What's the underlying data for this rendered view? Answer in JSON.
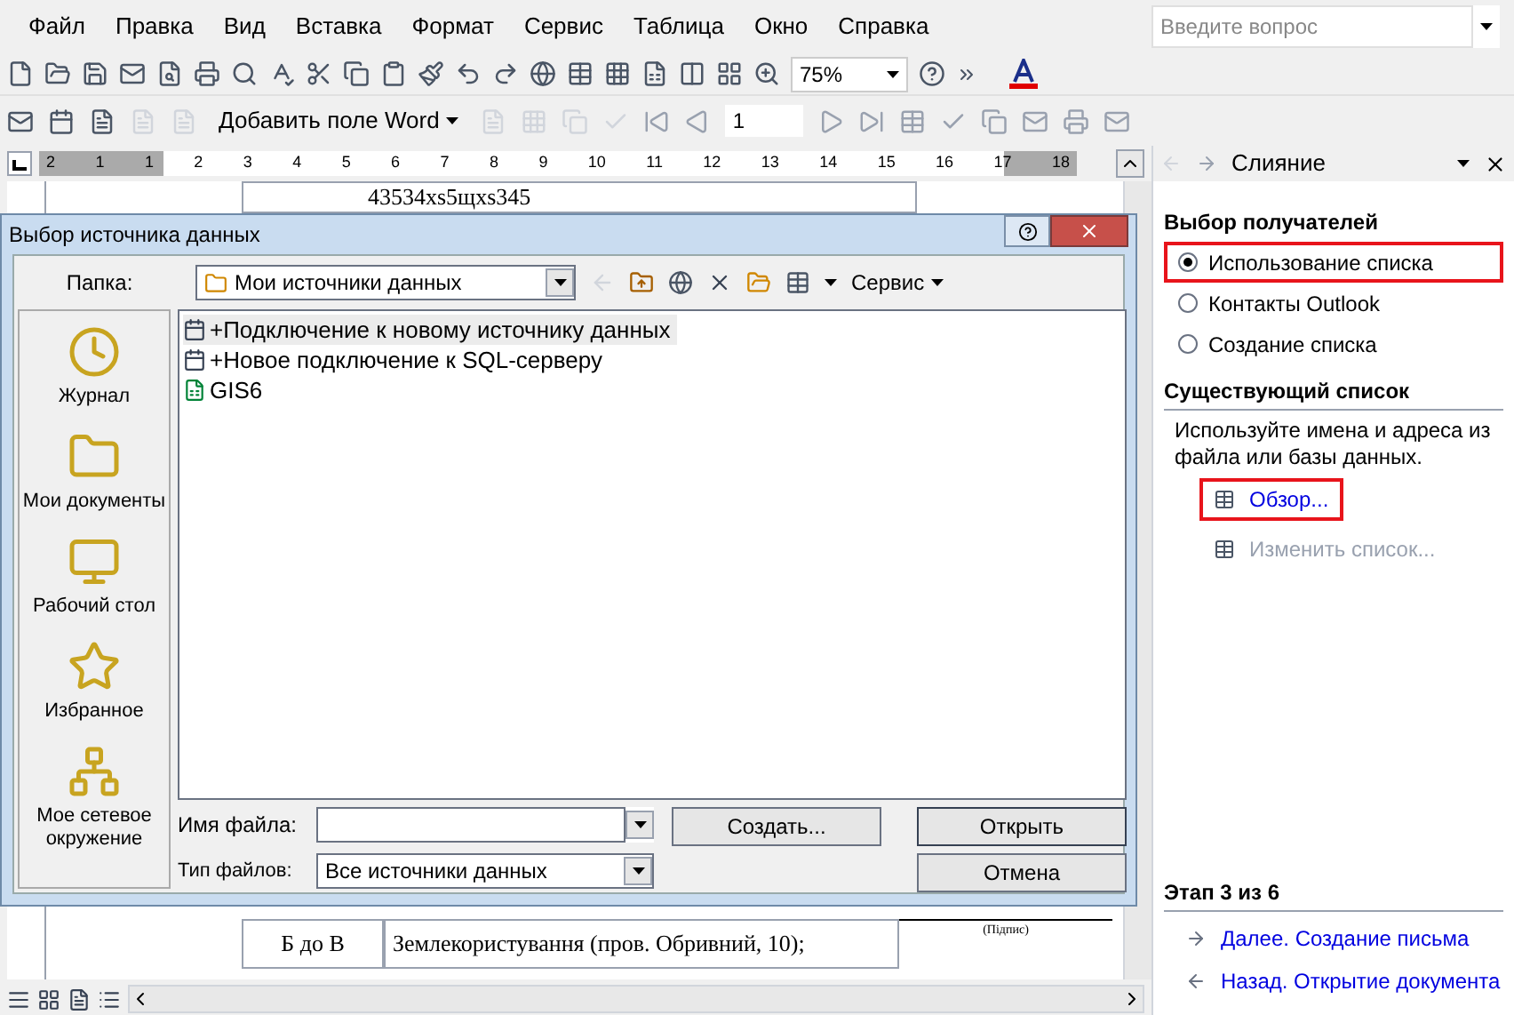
{
  "menu": [
    {
      "label": "Файл"
    },
    {
      "label": "Правка"
    },
    {
      "label": "Вид"
    },
    {
      "label": "Вставка"
    },
    {
      "label": "Формат"
    },
    {
      "label": "Сервис"
    },
    {
      "label": "Таблица"
    },
    {
      "label": "Окно"
    },
    {
      "label": "Справка"
    }
  ],
  "question_field": {
    "placeholder": "Введите вопрос"
  },
  "zoom": {
    "value": "75%"
  },
  "mailmerge_toolbar": {
    "insert_field": "Добавить поле Word",
    "record": "1"
  },
  "ruler": {
    "labels": [
      "2",
      "1",
      "1",
      "2",
      "3",
      "4",
      "5",
      "6",
      "7",
      "8",
      "9",
      "10",
      "11",
      "12",
      "13",
      "14",
      "15",
      "16",
      "17",
      "18"
    ]
  },
  "document": {
    "top_text": "43534xs5щxs345",
    "rows": [
      {
        "column_1": "Б до В",
        "column_2": "Землекористування  (пров. Обривний, 10);",
        "column_3": "(Підпис)"
      }
    ]
  },
  "task_pane": {
    "title": "Слияние",
    "recipients_heading": "Выбор получателей",
    "radios": [
      {
        "label": "Использование списка",
        "selected": true,
        "highlighted": true
      },
      {
        "label": "Контакты Outlook",
        "selected": false,
        "highlighted": false
      },
      {
        "label": "Создание списка",
        "selected": false,
        "highlighted": false
      }
    ],
    "existing_heading": "Существующий список",
    "description": "Используйте имена и адреса из файла или базы данных.",
    "links": [
      {
        "label": "Обзор...",
        "disabled": false,
        "highlighted": true
      },
      {
        "label": "Изменить список...",
        "disabled": true,
        "highlighted": false
      }
    ],
    "step": "Этап 3 из 6",
    "nav": [
      {
        "kind": "next",
        "label": "Далее. Создание письма"
      },
      {
        "kind": "back",
        "label": "Назад. Открытие документа"
      }
    ]
  },
  "dialog": {
    "title": "Выбор источника данных",
    "folder_label": "Папка:",
    "folder": "Мои источники данных",
    "tools": "Сервис",
    "places": [
      {
        "kind": "history",
        "label": "Журнал"
      },
      {
        "kind": "documents",
        "label": "Мои документы"
      },
      {
        "kind": "desktop",
        "label": "Рабочий стол"
      },
      {
        "kind": "favorites",
        "label": "Избранное"
      },
      {
        "kind": "network",
        "label": "Мое сетевое окружение"
      }
    ],
    "files": [
      {
        "kind": "connection",
        "name": "+Подключение к новому источнику данных",
        "selected": true
      },
      {
        "kind": "connection",
        "name": "+Новое подключение к SQL-серверу",
        "selected": false
      },
      {
        "kind": "excel",
        "name": "GIS6",
        "selected": false
      }
    ],
    "filename_label": "Имя файла:",
    "filetype_label": "Тип файлов:",
    "filetype": "Все источники данных",
    "buttons": [
      "Создать...",
      "Открыть",
      "Отмена"
    ]
  }
}
